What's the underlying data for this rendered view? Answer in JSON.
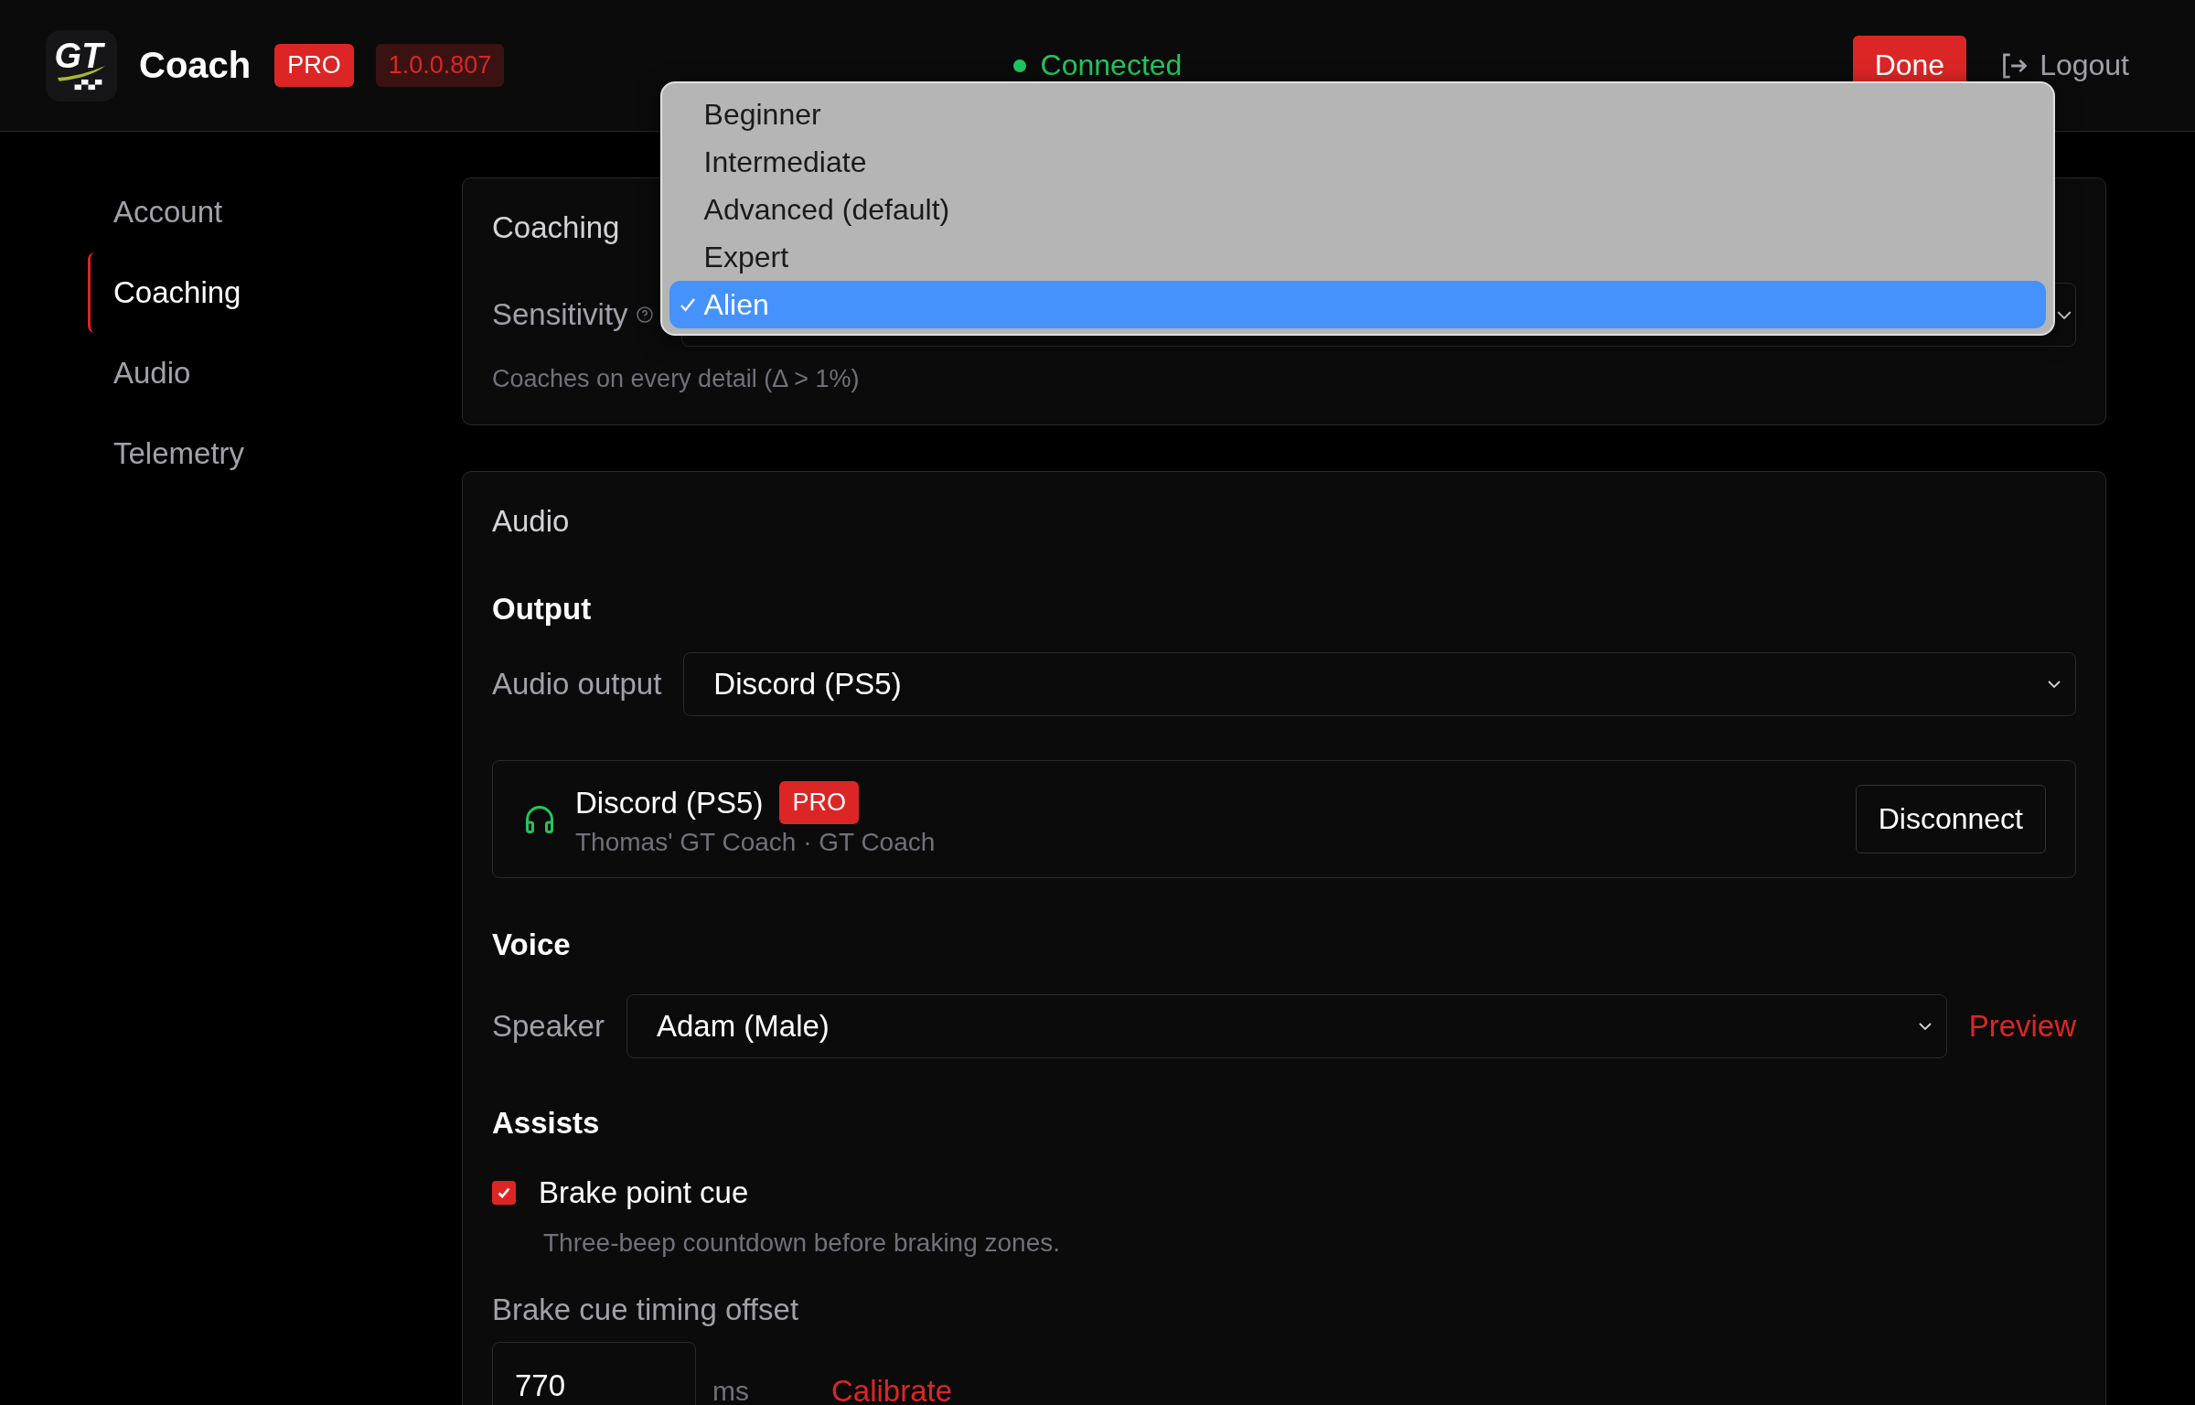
{
  "header": {
    "logo_text": "GT",
    "app_name": "Coach",
    "plan_badge": "PRO",
    "version": "1.0.0.807",
    "status": {
      "label": "Connected",
      "connected": true
    },
    "done_button": "Done",
    "logout_button": "Logout"
  },
  "sidebar": {
    "items": [
      {
        "label": "Account",
        "selected": false
      },
      {
        "label": "Coaching",
        "selected": true
      },
      {
        "label": "Audio",
        "selected": false
      },
      {
        "label": "Telemetry",
        "selected": false
      }
    ]
  },
  "coaching": {
    "title": "Coaching",
    "sensitivity": {
      "label": "Sensitivity",
      "hint": "Coaches on every detail (Δ > 1%)",
      "options": [
        {
          "label": "Beginner",
          "selected": false
        },
        {
          "label": "Intermediate",
          "selected": false
        },
        {
          "label": "Advanced (default)",
          "selected": false
        },
        {
          "label": "Expert",
          "selected": false
        },
        {
          "label": "Alien",
          "selected": true
        }
      ]
    }
  },
  "audio": {
    "title": "Audio",
    "output": {
      "heading": "Output",
      "label": "Audio output",
      "value": "Discord (PS5)",
      "device": {
        "name": "Discord (PS5)",
        "badge": "PRO",
        "subtitle": "Thomas' GT Coach · GT Coach",
        "button": "Disconnect"
      }
    },
    "voice": {
      "heading": "Voice",
      "label": "Speaker",
      "value": "Adam (Male)",
      "action": "Preview"
    },
    "assists": {
      "heading": "Assists",
      "brake_cue": {
        "label": "Brake point cue",
        "checked": true,
        "description": "Three-beep countdown before braking zones."
      },
      "offset": {
        "label": "Brake cue timing offset",
        "value": "770",
        "unit": "ms",
        "action": "Calibrate"
      }
    }
  }
}
